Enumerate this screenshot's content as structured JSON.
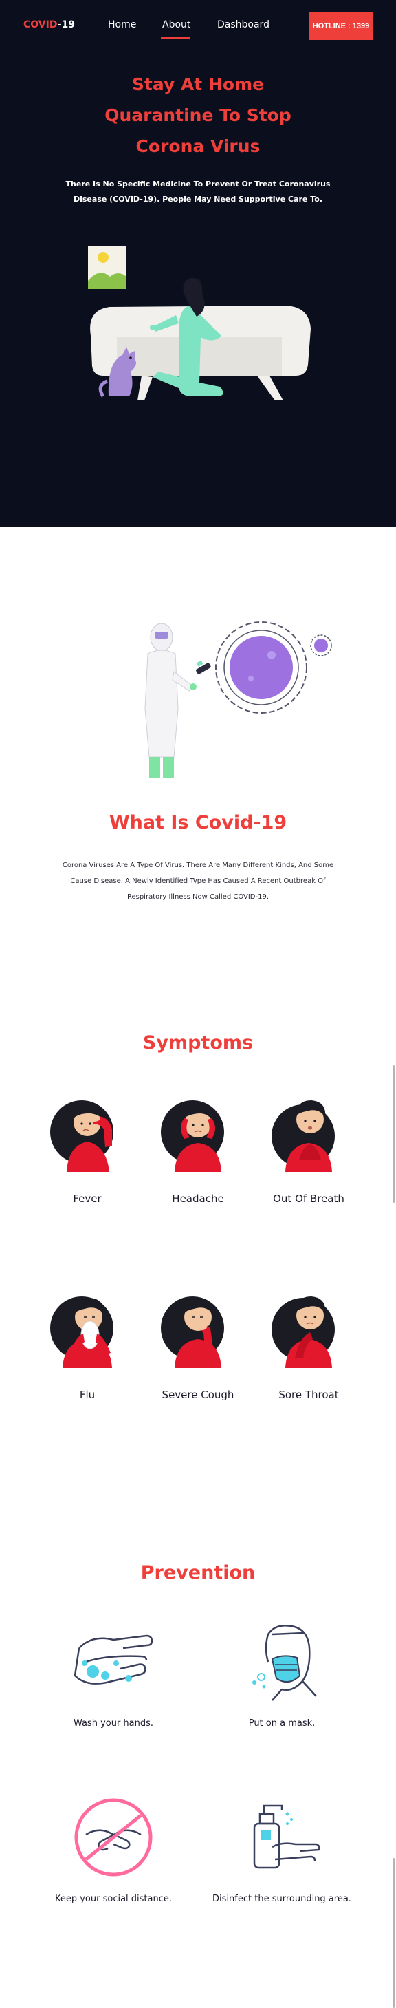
{
  "header": {
    "logo_part1": "COVID",
    "logo_part2": "-19",
    "nav": [
      {
        "label": "Home"
      },
      {
        "label": "About"
      },
      {
        "label": "Dashboard"
      }
    ],
    "hotline_label": "HOTLINE : 1399"
  },
  "hero": {
    "title_lines": [
      "Stay At Home",
      "Quarantine To Stop",
      "Corona Virus"
    ],
    "text": "There Is No Specific Medicine To Prevent Or Treat Coronavirus Disease (COVID-19). People May Need Supportive Care To."
  },
  "about": {
    "title": "What Is Covid-19",
    "text": "Corona Viruses Are A Type Of Virus. There Are Many Different Kinds, And Some Cause Disease. A Newly Identified Type Has Caused A Recent Outbreak Of Respiratory Illness Now Called COVID-19."
  },
  "symptoms": {
    "title": "Symptoms",
    "items": [
      {
        "label": "Fever",
        "icon": "fever-person-icon"
      },
      {
        "label": "Headache",
        "icon": "headache-person-icon"
      },
      {
        "label": "Out Of Breath",
        "icon": "breath-person-icon"
      },
      {
        "label": "Flu",
        "icon": "flu-person-icon"
      },
      {
        "label": "Severe Cough",
        "icon": "cough-person-icon"
      },
      {
        "label": "Sore Throat",
        "icon": "throat-person-icon"
      }
    ]
  },
  "prevention": {
    "title": "Prevention",
    "items": [
      {
        "label": "Wash your hands.",
        "icon": "hand-wash-icon"
      },
      {
        "label": "Put on a mask.",
        "icon": "mask-icon"
      },
      {
        "label": "Keep your social distance.",
        "icon": "no-handshake-icon"
      },
      {
        "label": "Disinfect the surrounding area.",
        "icon": "sanitizer-icon"
      }
    ]
  },
  "colors": {
    "accent": "#ef3f3b",
    "hero_bg": "#0b0e1d",
    "symptom_shirt": "#e3182d",
    "prevention_stroke": "#3a3f5c",
    "prevention_accent": "#4fd1e8"
  }
}
